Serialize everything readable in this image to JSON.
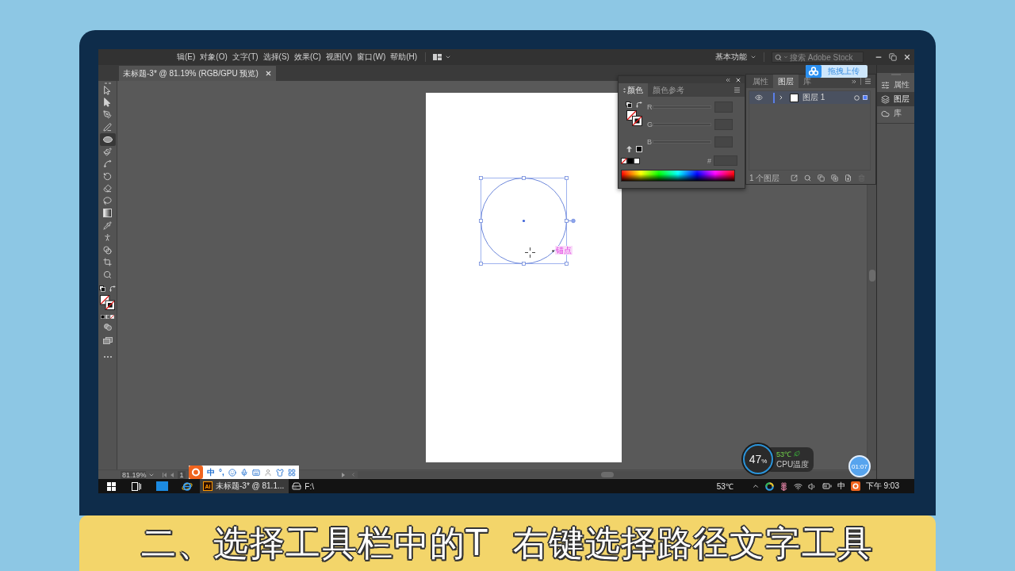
{
  "menu_bar": {
    "items": [
      "辑(E)",
      "对象(O)",
      "文字(T)",
      "选择(S)",
      "效果(C)",
      "视图(V)",
      "窗口(W)",
      "帮助(H)"
    ],
    "workspace": "基本功能",
    "search": {
      "placeholder": "搜索 Adobe Stock"
    }
  },
  "upload_button": {
    "label": "拖拽上传"
  },
  "document_tab": {
    "title": "未标题-3* @ 81.19% (RGB/GPU 预览)",
    "selected": true
  },
  "tools": [
    {
      "selected": false
    },
    {
      "selected": false
    },
    {
      "selected": false
    },
    {
      "selected": false
    },
    {
      "selected": true
    },
    {
      "selected": false
    },
    {
      "selected": false
    },
    {
      "selected": false
    },
    {
      "selected": false
    },
    {
      "selected": false
    },
    {
      "selected": false
    },
    {
      "selected": false
    },
    {
      "selected": false
    },
    {
      "selected": false
    },
    {
      "selected": false
    },
    {
      "selected": false
    }
  ],
  "color_panel": {
    "tabs": [
      {
        "label": "颜色",
        "selected": true
      },
      {
        "label": "颜色参考",
        "selected": false
      }
    ],
    "channels": [
      {
        "label": "R",
        "level": 0
      },
      {
        "label": "G",
        "level": 0
      },
      {
        "label": "B",
        "level": 0
      }
    ],
    "hex_label": "#"
  },
  "layers_panel": {
    "tabs": [
      {
        "label": "属性",
        "selected": false
      },
      {
        "label": "图层",
        "selected": true
      },
      {
        "label": "库",
        "selected": false
      }
    ],
    "layers": [
      {
        "name": "图层 1",
        "visible": true,
        "expanded": false,
        "selected": true
      }
    ],
    "footer": "1 个图层"
  },
  "dock": [
    {
      "label": "属性",
      "selected": false
    },
    {
      "label": "图层",
      "selected": true
    },
    {
      "label": "库",
      "selected": false
    }
  ],
  "artboard": {
    "guide_label": "锚点"
  },
  "status_bar": {
    "zoom": "81.19%",
    "page": "1"
  },
  "ime_bar": {
    "mode": "中",
    "punctuation": "°,"
  },
  "cpu_widget": {
    "usage": "47",
    "unit": "%",
    "temperature": "53℃",
    "label": "CPU温度"
  },
  "timer": "01:07",
  "taskbar": {
    "items": [
      {
        "selected": false
      },
      {
        "selected": false
      },
      {
        "selected": false
      },
      {
        "selected": false
      },
      {
        "badge": "Ai",
        "label": "未标题-3* @ 81.1...",
        "selected": true
      },
      {
        "label": "F:\\",
        "selected": false
      }
    ],
    "temperature": "53℃",
    "ime": "中",
    "time": "下午 9:03"
  },
  "caption": "二、选择工具栏中的T  右键选择路径文字工具"
}
